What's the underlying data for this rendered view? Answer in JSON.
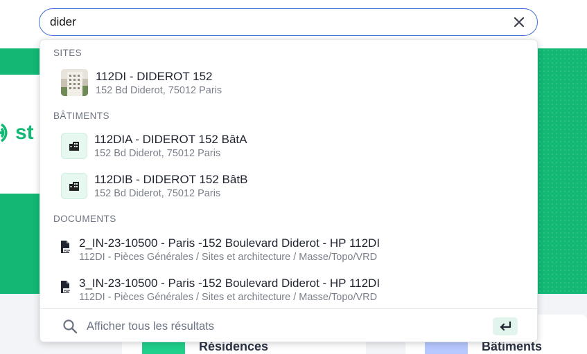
{
  "search": {
    "value": "dider",
    "clear_icon": "close-icon"
  },
  "dropdown": {
    "sections": {
      "sites": "SITES",
      "buildings": "BÂTIMENTS",
      "documents": "DOCUMENTS"
    },
    "sites": [
      {
        "title": "112DI - DIDEROT 152",
        "subtitle": "152 Bd Diderot, 75012 Paris",
        "icon": "building-photo-thumbnail"
      }
    ],
    "buildings": [
      {
        "title": "112DIA - DIDEROT 152 BâtA",
        "subtitle": "152 Bd Diderot, 75012 Paris",
        "icon": "building-icon"
      },
      {
        "title": "112DIB - DIDEROT 152 BâtB",
        "subtitle": "152 Bd Diderot, 75012 Paris",
        "icon": "building-icon"
      }
    ],
    "documents": [
      {
        "title": "2_IN-23-10500 - Paris -152 Boulevard Diderot - HP 112DI",
        "subtitle": "112DI - Pièces Générales / Sites et architecture / Masse/Topo/VRD",
        "icon": "pdf-file-icon"
      },
      {
        "title": "3_IN-23-10500 - Paris -152 Boulevard Diderot - HP 112DI",
        "subtitle": "112DI - Pièces Générales / Sites et architecture / Masse/Topo/VRD",
        "icon": "pdf-file-icon"
      }
    ],
    "footer": {
      "label": "Afficher tous les résultats",
      "search_icon": "search-icon",
      "enter_icon": "enter-key-icon"
    }
  },
  "background": {
    "logo_text": "st",
    "tiles": [
      {
        "label": "Résidences"
      },
      {
        "label": "Bâtiments"
      }
    ]
  },
  "colors": {
    "accent_green": "#12b873",
    "focus_blue": "#3d6fd6",
    "icon_bg_green": "#e6f8ef"
  }
}
